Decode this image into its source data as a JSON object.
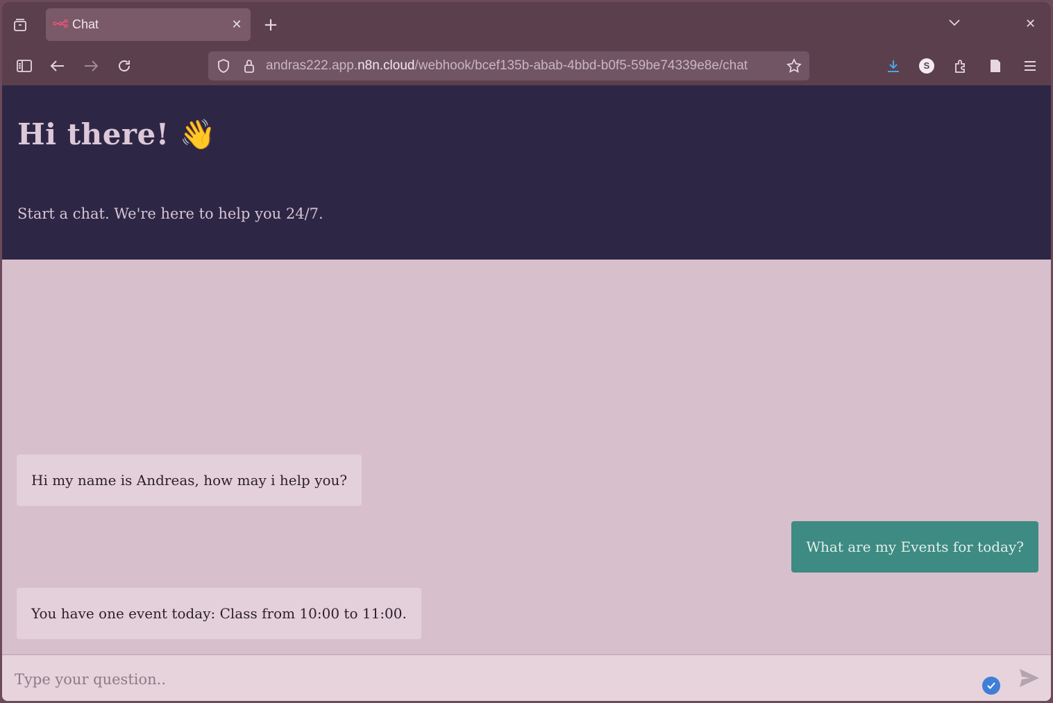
{
  "browser": {
    "tab_title": "Chat",
    "tab_favicon": "n8n-icon",
    "url_prefix": "andras222.app.",
    "url_host": "n8n.cloud",
    "url_path": "/webhook/bcef135b-abab-4bbd-b0f5-59be74339e8e/chat",
    "profile_initial": "S"
  },
  "header": {
    "title": "Hi there! 👋",
    "subtitle": "Start a chat. We're here to help you 24/7."
  },
  "messages": [
    {
      "sender": "bot",
      "text": "Hi my name is Andreas, how may i help you?"
    },
    {
      "sender": "user",
      "text": "What are my Events for today?"
    },
    {
      "sender": "bot",
      "text": "You have one event today: Class from 10:00 to 11:00."
    }
  ],
  "composer": {
    "placeholder": "Type your question.."
  },
  "colors": {
    "header_bg": "#2e2645",
    "user_bubble": "#3d8b82",
    "bot_bubble": "#e4d0da"
  }
}
